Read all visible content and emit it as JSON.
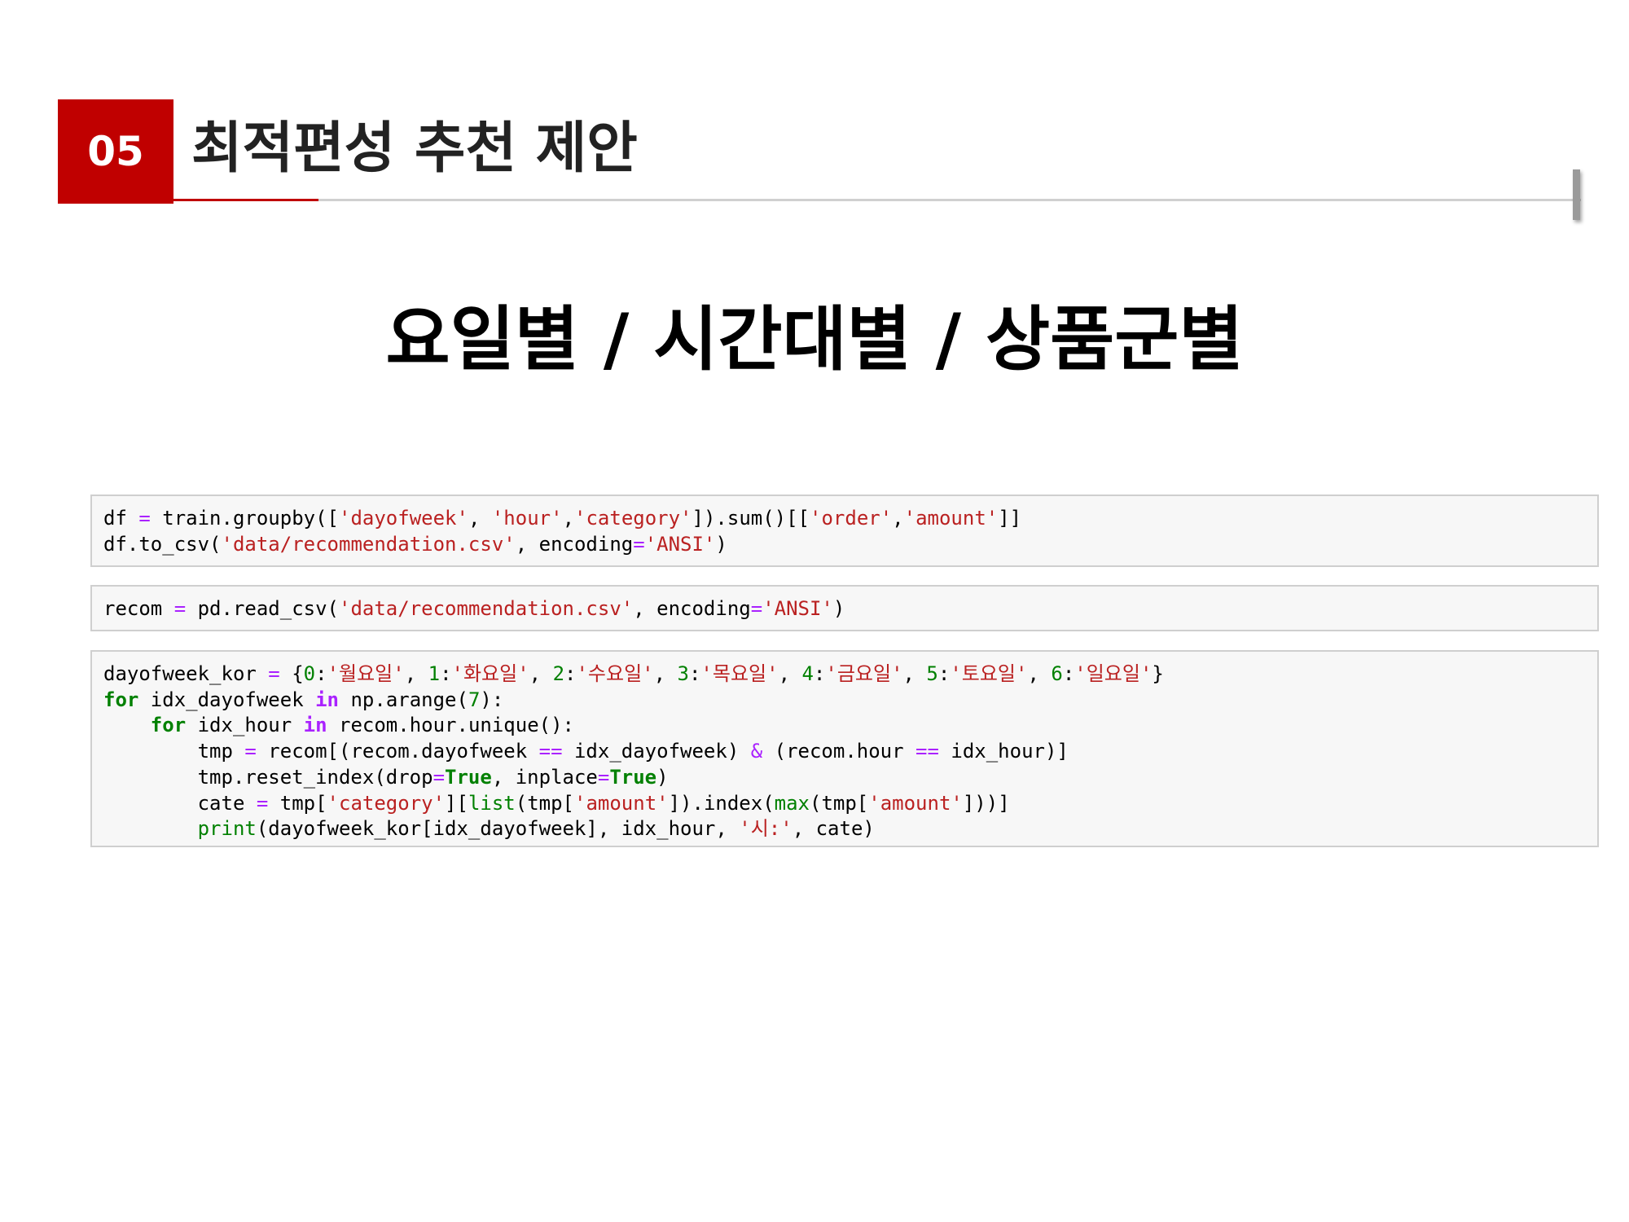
{
  "header": {
    "number": "05",
    "title": "최적편성 추천 제안"
  },
  "subtitle": "요일별 / 시간대별 / 상품군별",
  "colors": {
    "accent": "#c00000",
    "code_string": "#ba2121",
    "code_keyword": "#008000",
    "code_operator": "#aa22ff",
    "code_background": "#f7f7f7"
  },
  "code_cells": [
    {
      "lines": [
        [
          {
            "t": "df ",
            "c": "plain"
          },
          {
            "t": "=",
            "c": "op"
          },
          {
            "t": " train.groupby([",
            "c": "plain"
          },
          {
            "t": "'dayofweek'",
            "c": "str"
          },
          {
            "t": ", ",
            "c": "plain"
          },
          {
            "t": "'hour'",
            "c": "str"
          },
          {
            "t": ",",
            "c": "plain"
          },
          {
            "t": "'category'",
            "c": "str"
          },
          {
            "t": "]).sum()[[",
            "c": "plain"
          },
          {
            "t": "'order'",
            "c": "str"
          },
          {
            "t": ",",
            "c": "plain"
          },
          {
            "t": "'amount'",
            "c": "str"
          },
          {
            "t": "]]",
            "c": "plain"
          }
        ],
        [
          {
            "t": "df.to_csv(",
            "c": "plain"
          },
          {
            "t": "'data/recommendation.csv'",
            "c": "str"
          },
          {
            "t": ", encoding",
            "c": "plain"
          },
          {
            "t": "=",
            "c": "op"
          },
          {
            "t": "'ANSI'",
            "c": "str"
          },
          {
            "t": ")",
            "c": "plain"
          }
        ]
      ]
    },
    {
      "lines": [
        [
          {
            "t": "recom ",
            "c": "plain"
          },
          {
            "t": "=",
            "c": "op"
          },
          {
            "t": " pd.read_csv(",
            "c": "plain"
          },
          {
            "t": "'data/recommendation.csv'",
            "c": "str"
          },
          {
            "t": ", encoding",
            "c": "plain"
          },
          {
            "t": "=",
            "c": "op"
          },
          {
            "t": "'ANSI'",
            "c": "str"
          },
          {
            "t": ")",
            "c": "plain"
          }
        ]
      ]
    },
    {
      "lines": [
        [
          {
            "t": "dayofweek_kor ",
            "c": "plain"
          },
          {
            "t": "=",
            "c": "op"
          },
          {
            "t": " {",
            "c": "plain"
          },
          {
            "t": "0",
            "c": "num"
          },
          {
            "t": ":",
            "c": "plain"
          },
          {
            "t": "'월요일'",
            "c": "str"
          },
          {
            "t": ", ",
            "c": "plain"
          },
          {
            "t": "1",
            "c": "num"
          },
          {
            "t": ":",
            "c": "plain"
          },
          {
            "t": "'화요일'",
            "c": "str"
          },
          {
            "t": ", ",
            "c": "plain"
          },
          {
            "t": "2",
            "c": "num"
          },
          {
            "t": ":",
            "c": "plain"
          },
          {
            "t": "'수요일'",
            "c": "str"
          },
          {
            "t": ", ",
            "c": "plain"
          },
          {
            "t": "3",
            "c": "num"
          },
          {
            "t": ":",
            "c": "plain"
          },
          {
            "t": "'목요일'",
            "c": "str"
          },
          {
            "t": ", ",
            "c": "plain"
          },
          {
            "t": "4",
            "c": "num"
          },
          {
            "t": ":",
            "c": "plain"
          },
          {
            "t": "'금요일'",
            "c": "str"
          },
          {
            "t": ", ",
            "c": "plain"
          },
          {
            "t": "5",
            "c": "num"
          },
          {
            "t": ":",
            "c": "plain"
          },
          {
            "t": "'토요일'",
            "c": "str"
          },
          {
            "t": ", ",
            "c": "plain"
          },
          {
            "t": "6",
            "c": "num"
          },
          {
            "t": ":",
            "c": "plain"
          },
          {
            "t": "'일요일'",
            "c": "str"
          },
          {
            "t": "}",
            "c": "plain"
          }
        ],
        [
          {
            "t": "for",
            "c": "kw"
          },
          {
            "t": " idx_dayofweek ",
            "c": "plain"
          },
          {
            "t": "in",
            "c": "opb"
          },
          {
            "t": " np.arange(",
            "c": "plain"
          },
          {
            "t": "7",
            "c": "num"
          },
          {
            "t": "):",
            "c": "plain"
          }
        ],
        [
          {
            "t": "    ",
            "c": "plain"
          },
          {
            "t": "for",
            "c": "kw"
          },
          {
            "t": " idx_hour ",
            "c": "plain"
          },
          {
            "t": "in",
            "c": "opb"
          },
          {
            "t": " recom.hour.unique():",
            "c": "plain"
          }
        ],
        [
          {
            "t": "        tmp ",
            "c": "plain"
          },
          {
            "t": "=",
            "c": "op"
          },
          {
            "t": " recom[(recom.dayofweek ",
            "c": "plain"
          },
          {
            "t": "==",
            "c": "op"
          },
          {
            "t": " idx_dayofweek) ",
            "c": "plain"
          },
          {
            "t": "&",
            "c": "op"
          },
          {
            "t": " (recom.hour ",
            "c": "plain"
          },
          {
            "t": "==",
            "c": "op"
          },
          {
            "t": " idx_hour)]",
            "c": "plain"
          }
        ],
        [
          {
            "t": "        tmp.reset_index(drop",
            "c": "plain"
          },
          {
            "t": "=",
            "c": "op"
          },
          {
            "t": "True",
            "c": "kw"
          },
          {
            "t": ", inplace",
            "c": "plain"
          },
          {
            "t": "=",
            "c": "op"
          },
          {
            "t": "True",
            "c": "kw"
          },
          {
            "t": ")",
            "c": "plain"
          }
        ],
        [
          {
            "t": "        cate ",
            "c": "plain"
          },
          {
            "t": "=",
            "c": "op"
          },
          {
            "t": " tmp[",
            "c": "plain"
          },
          {
            "t": "'category'",
            "c": "str"
          },
          {
            "t": "][",
            "c": "plain"
          },
          {
            "t": "list",
            "c": "bi"
          },
          {
            "t": "(tmp[",
            "c": "plain"
          },
          {
            "t": "'amount'",
            "c": "str"
          },
          {
            "t": "]).index(",
            "c": "plain"
          },
          {
            "t": "max",
            "c": "bi"
          },
          {
            "t": "(tmp[",
            "c": "plain"
          },
          {
            "t": "'amount'",
            "c": "str"
          },
          {
            "t": "]))]",
            "c": "plain"
          }
        ],
        [
          {
            "t": "        ",
            "c": "plain"
          },
          {
            "t": "print",
            "c": "bi"
          },
          {
            "t": "(dayofweek_kor[idx_dayofweek], idx_hour, ",
            "c": "plain"
          },
          {
            "t": "'시:'",
            "c": "str"
          },
          {
            "t": ", cate)",
            "c": "plain"
          }
        ]
      ]
    }
  ]
}
